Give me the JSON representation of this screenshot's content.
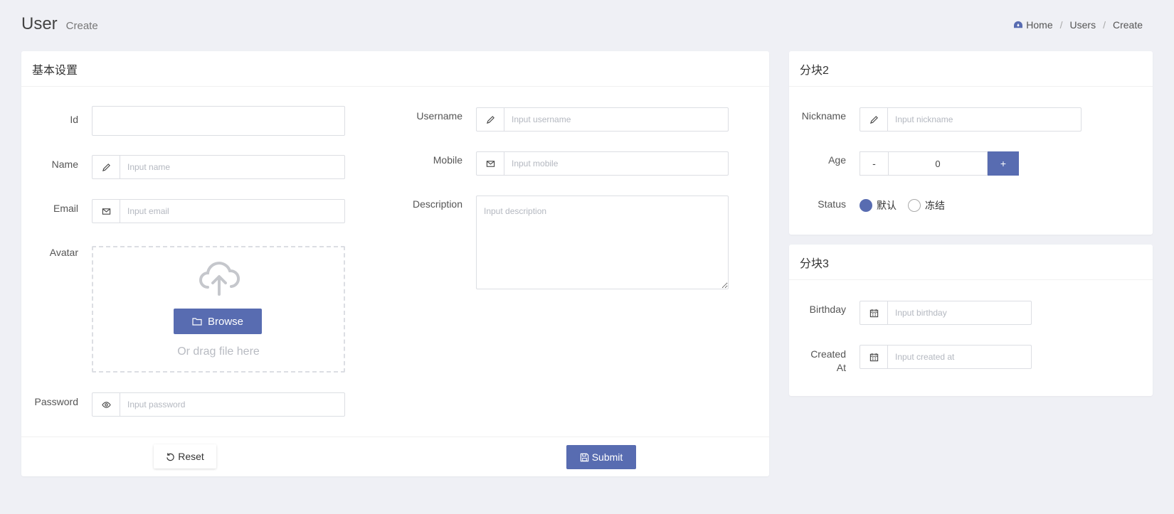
{
  "header": {
    "title": "User",
    "subtitle": "Create"
  },
  "breadcrumb": {
    "home": "Home",
    "sep1": "/",
    "users": "Users",
    "sep2": "/",
    "create": "Create"
  },
  "card1": {
    "title": "基本设置",
    "fields": {
      "id": {
        "label": "Id",
        "value": ""
      },
      "name": {
        "label": "Name",
        "placeholder": "Input name",
        "icon": "pencil-icon"
      },
      "email": {
        "label": "Email",
        "placeholder": "Input email",
        "icon": "envelope-icon"
      },
      "avatar": {
        "label": "Avatar",
        "browse": "Browse",
        "drag": "Or drag file here"
      },
      "password": {
        "label": "Password",
        "placeholder": "Input password",
        "icon": "eye-icon"
      },
      "username": {
        "label": "Username",
        "placeholder": "Input username",
        "icon": "pencil-icon"
      },
      "mobile": {
        "label": "Mobile",
        "placeholder": "Input mobile",
        "icon": "envelope-icon"
      },
      "description": {
        "label": "Description",
        "placeholder": "Input description"
      }
    },
    "reset": "Reset",
    "submit": "Submit"
  },
  "card2": {
    "title": "分块2",
    "nickname": {
      "label": "Nickname",
      "placeholder": "Input nickname",
      "icon": "pencil-icon"
    },
    "age": {
      "label": "Age",
      "minus": "-",
      "value": "0",
      "plus": "+"
    },
    "status": {
      "label": "Status",
      "options": [
        "默认",
        "冻结"
      ],
      "selected": "默认"
    }
  },
  "card3": {
    "title": "分块3",
    "birthday": {
      "label": "Birthday",
      "placeholder": "Input birthday",
      "icon": "calendar-icon"
    },
    "created_at": {
      "label_line1": "Created",
      "label_line2": "At",
      "placeholder": "Input created at",
      "icon": "calendar-icon"
    }
  },
  "colors": {
    "primary": "#586cb1",
    "background": "#eff0f5"
  }
}
